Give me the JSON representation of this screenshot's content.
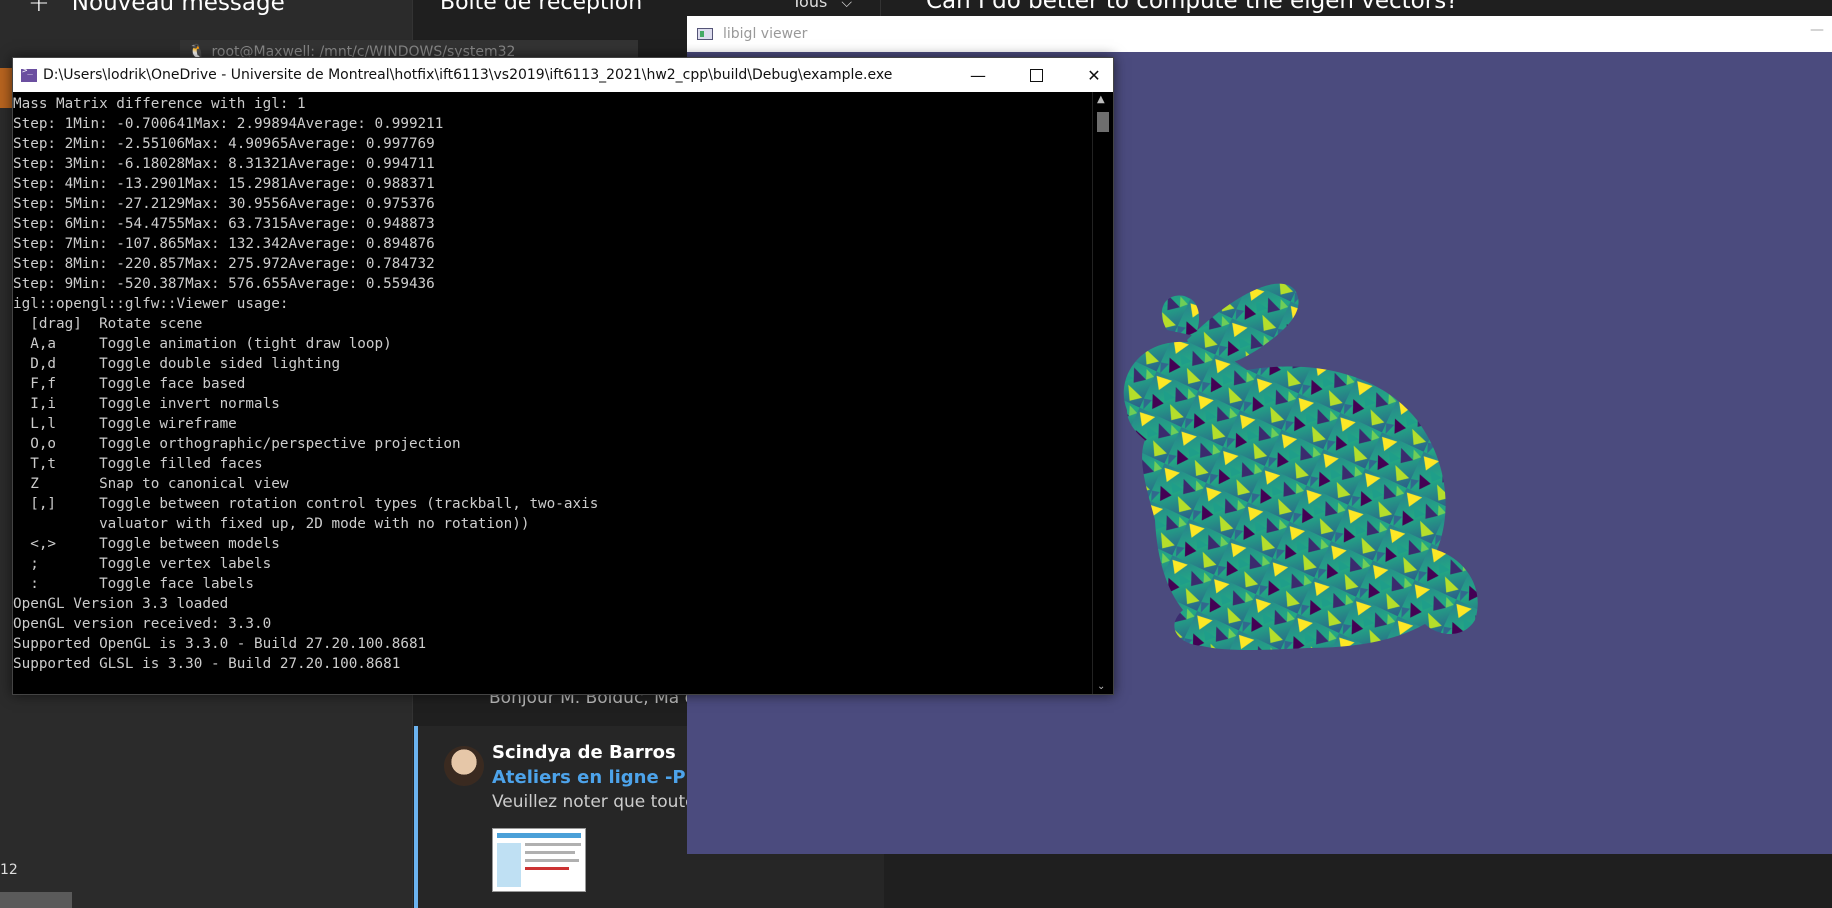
{
  "mail": {
    "new_message_label": "Nouveau message",
    "inbox_title": "Boîte de réception",
    "filter_label": "Tous",
    "reading_title": "Can I do better to compute the eigen vectors?",
    "wsl_tab_title": "root@Maxwell: /mnt/c/WINDOWS/system32",
    "left_number": "12",
    "preview_1": "Bonjour M. Bolduc, Ma q",
    "item_2": {
      "sender": "Scindya de Barros",
      "subject": "Ateliers en ligne -Projet",
      "snippet": "Veuillez noter que toute"
    }
  },
  "viewer": {
    "title": "libigl viewer",
    "minimize_glyph": "—",
    "background_color": "#4b4b7e"
  },
  "console": {
    "title": "D:\\Users\\lodrik\\OneDrive - Universite de Montreal\\hotfix\\ift6113\\vs2019\\ift6113_2021\\hw2_cpp\\build\\Debug\\example.exe",
    "minimize_glyph": "—",
    "close_glyph": "✕",
    "lines": [
      "Mass Matrix difference with igl: 1",
      "Step: 1Min: -0.700641Max: 2.99894Average: 0.999211",
      "Step: 2Min: -2.55106Max: 4.90965Average: 0.997769",
      "Step: 3Min: -6.18028Max: 8.31321Average: 0.994711",
      "Step: 4Min: -13.2901Max: 15.2981Average: 0.988371",
      "Step: 5Min: -27.2129Max: 30.9556Average: 0.975376",
      "Step: 6Min: -54.4755Max: 63.7315Average: 0.948873",
      "Step: 7Min: -107.865Max: 132.342Average: 0.894876",
      "Step: 8Min: -220.857Max: 275.972Average: 0.784732",
      "Step: 9Min: -520.387Max: 576.655Average: 0.559436",
      "igl::opengl::glfw::Viewer usage:",
      "  [drag]  Rotate scene",
      "  A,a     Toggle animation (tight draw loop)",
      "  D,d     Toggle double sided lighting",
      "  F,f     Toggle face based",
      "  I,i     Toggle invert normals",
      "  L,l     Toggle wireframe",
      "  O,o     Toggle orthographic/perspective projection",
      "  T,t     Toggle filled faces",
      "  Z       Snap to canonical view",
      "  [,]     Toggle between rotation control types (trackball, two-axis",
      "          valuator with fixed up, 2D mode with no rotation))",
      "  <,>     Toggle between models",
      "  ;       Toggle vertex labels",
      "  :       Toggle face labels",
      "OpenGL Version 3.3 loaded",
      "OpenGL version received: 3.3.0",
      "Supported OpenGL is 3.3.0 - Build 27.20.100.8681",
      "Supported GLSL is 3.30 - Build 27.20.100.8681"
    ]
  },
  "icons": {
    "plus": "+",
    "chevron_down": "⌵",
    "scroll_up": "▲",
    "scroll_down": "⌄",
    "tux": "🐧"
  }
}
